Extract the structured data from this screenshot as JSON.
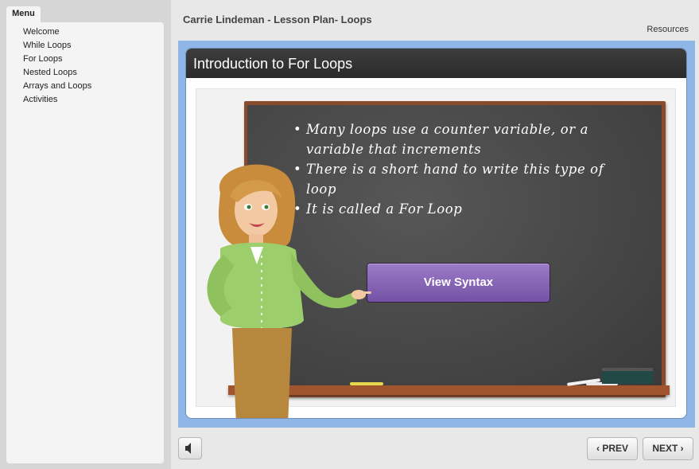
{
  "sidebar": {
    "menu_label": "Menu",
    "items": [
      {
        "label": "Welcome"
      },
      {
        "label": "While Loops"
      },
      {
        "label": "For Loops"
      },
      {
        "label": "Nested Loops"
      },
      {
        "label": "Arrays and Loops"
      },
      {
        "label": "Activities"
      }
    ]
  },
  "header": {
    "title": "Carrie Lindeman - Lesson Plan- Loops",
    "resources_label": "Resources"
  },
  "slide": {
    "heading": "Introduction to For Loops",
    "bullets": [
      "Many loops use a counter variable, or a variable that increments",
      "There is a short hand to write this type of loop",
      "It is called a For Loop"
    ],
    "button_label": "View Syntax"
  },
  "footer": {
    "audio_icon": "speaker-icon",
    "prev_label": "PREV",
    "next_label": "NEXT",
    "prev_icon": "chevron-left-icon",
    "next_icon": "chevron-right-icon"
  },
  "colors": {
    "stage_blue": "#8fb6e6",
    "header_dark": "#333333",
    "button_purple": "#7e5cb0",
    "chalkboard": "#4a4a4a",
    "board_frame": "#8a4b2c"
  }
}
